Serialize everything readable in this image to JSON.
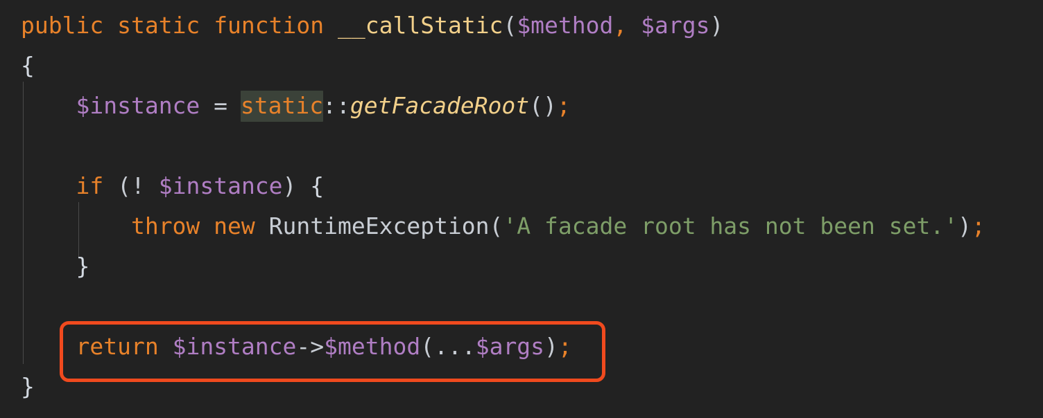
{
  "editor": {
    "language": "php",
    "theme": "dark",
    "background_color": "#222222",
    "font_size_px": 33,
    "line_height_px": 58,
    "colors": {
      "keyword": "#E8822A",
      "function_name": "#F2D08A",
      "static_method_call": "#F2D08A",
      "variable": "#B07EC4",
      "punctuation": "#C8CDD4",
      "class_name": "#C8CDD4",
      "string": "#7E9E68",
      "semicolon": "#E8822A",
      "brace": "#D4DAE2",
      "occurrence_highlight": "#3B4239",
      "indent_guide": "#4A4A4A",
      "annotation": "#F04A1E"
    }
  },
  "code": {
    "line1": {
      "kw_public": "public",
      "space1": " ",
      "kw_static": "static",
      "space2": " ",
      "kw_function": "function",
      "space3": " ",
      "method_name": "__callStatic",
      "paren_open": "(",
      "param1": "$method",
      "comma": ", ",
      "param2": "$args",
      "paren_close": ")"
    },
    "line2": {
      "brace_open": "{"
    },
    "line3": {
      "indent": "    ",
      "var_instance": "$instance",
      "assign": " = ",
      "kw_static_hl": "static",
      "scope_res": "::",
      "static_call": "getFacadeRoot",
      "parens": "()",
      "semicolon": ";"
    },
    "line5": {
      "indent": "    ",
      "kw_if": "if",
      "cond_open": " (",
      "not_op": "! ",
      "var_instance": "$instance",
      "cond_close": ")",
      "brace_open": " {"
    },
    "line6": {
      "indent": "        ",
      "kw_throw": "throw",
      "space1": " ",
      "kw_new": "new",
      "space2": " ",
      "class_name": "RuntimeException",
      "paren_open": "(",
      "string": "'A facade root has not been set.'",
      "paren_close": ")",
      "semicolon": ";"
    },
    "line7": {
      "indent": "    ",
      "brace_close": "}"
    },
    "line9": {
      "indent": "    ",
      "kw_return": "return",
      "space1": " ",
      "var_instance": "$instance",
      "arrow": "->",
      "var_method": "$method",
      "paren_open": "(",
      "spread": "...",
      "var_args": "$args",
      "paren_close": ")",
      "semicolon": ";"
    },
    "line10": {
      "brace_close": "}"
    }
  },
  "annotation": {
    "label": "return $instance->$method(...$args);",
    "shape": "rounded-rectangle-outline",
    "color": "#F04A1E",
    "stroke_width_px": 5,
    "target_line": 9
  }
}
